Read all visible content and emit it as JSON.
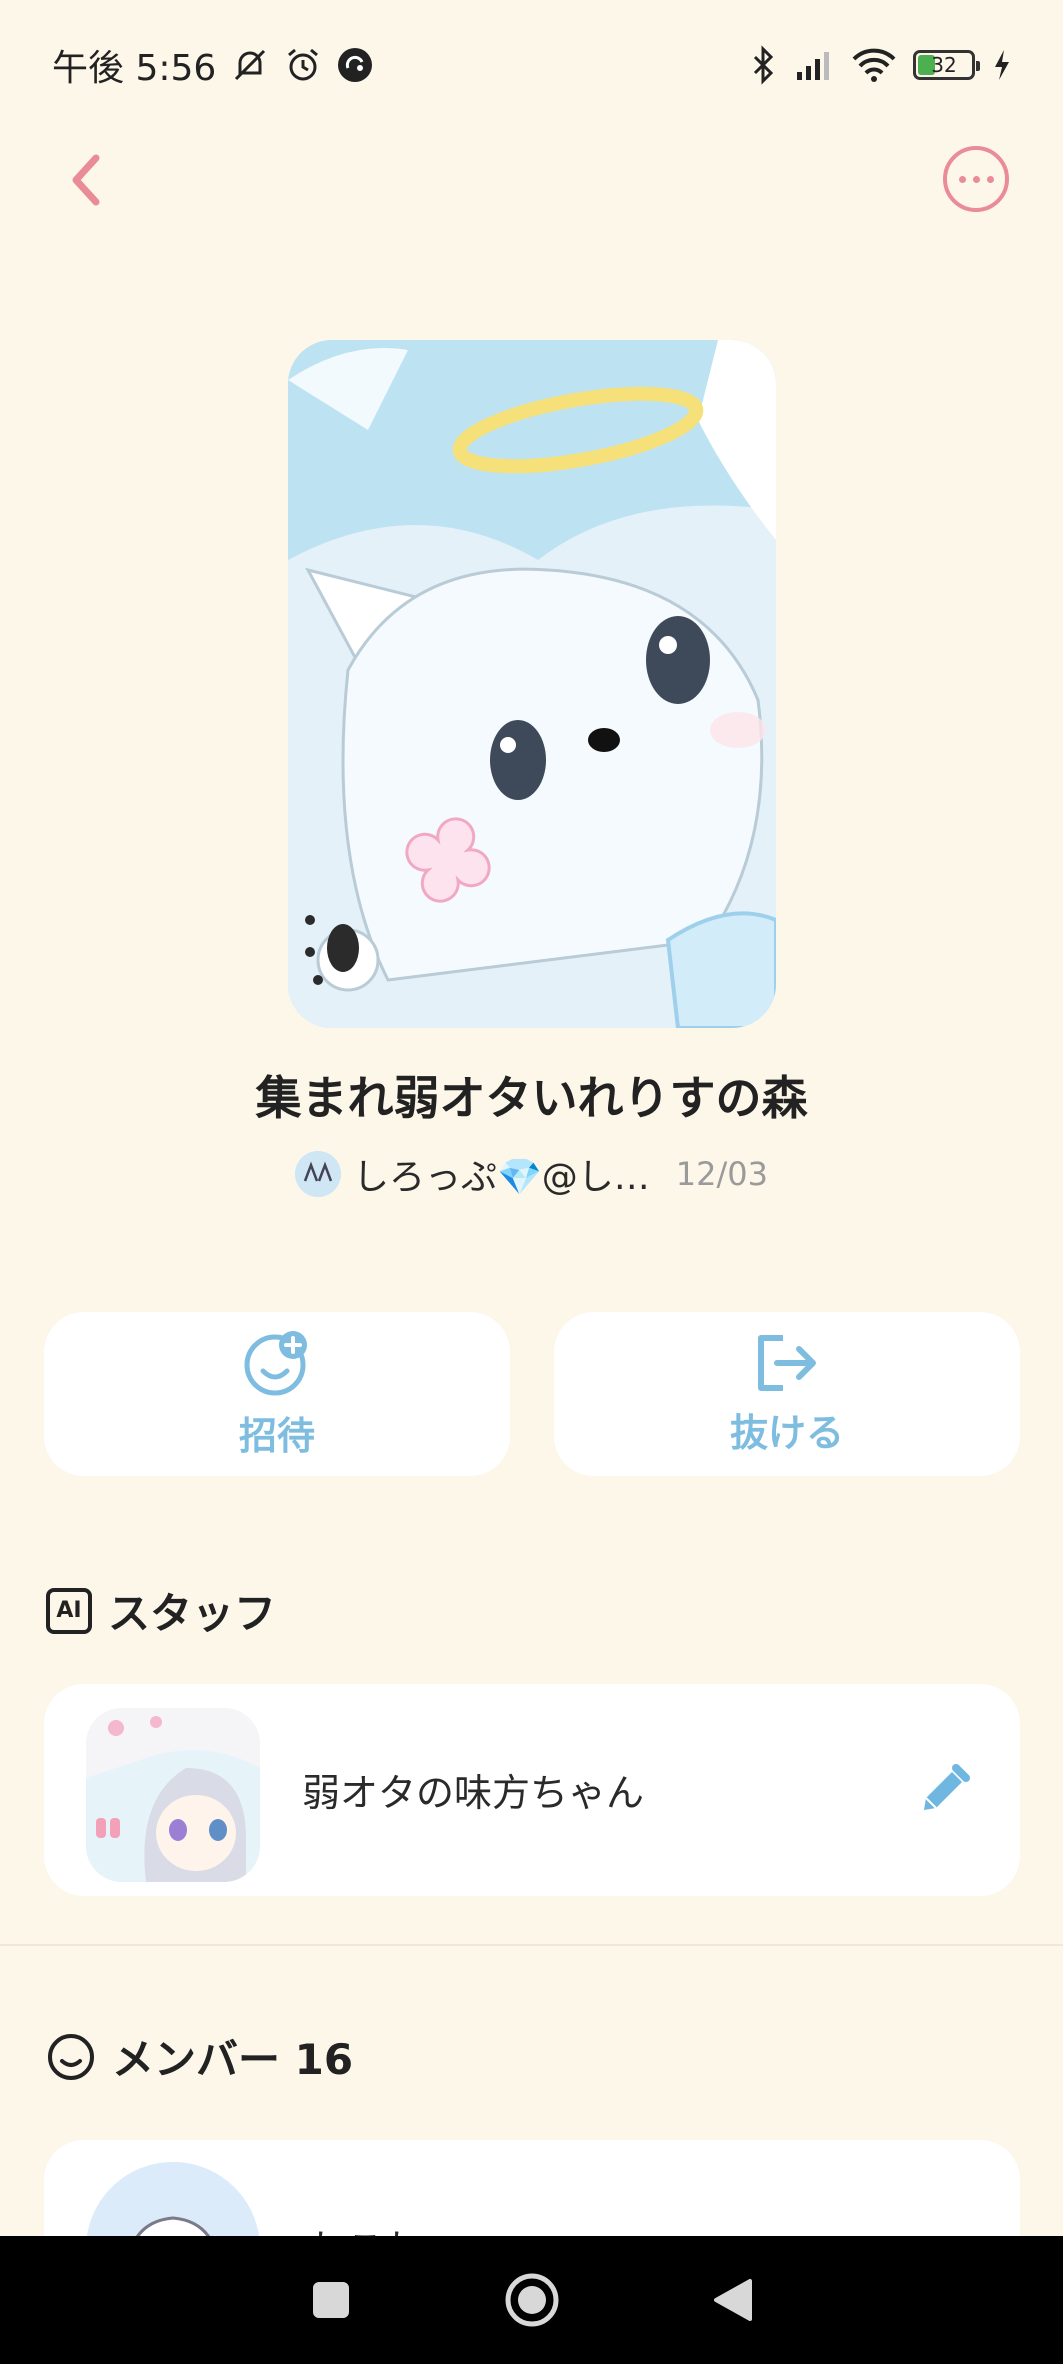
{
  "status_bar": {
    "time": "午後 5:56",
    "battery_level": "32",
    "icons": [
      "mute-icon",
      "alarm-icon",
      "vpn-icon",
      "bluetooth-icon",
      "signal-icon",
      "wifi-icon",
      "battery-icon",
      "charging-icon"
    ]
  },
  "nav": {
    "back_icon": "chevron-left-icon",
    "more_icon": "more-horizontal-icon",
    "accent_color": "#E98C97"
  },
  "group": {
    "title": "集まれ弱オタいれりすの森",
    "owner_name": "しろっぷ💎@し…",
    "created_date": "12/03"
  },
  "actions": {
    "invite_label": "招待",
    "leave_label": "抜ける",
    "color": "#7EBDE0"
  },
  "staff_section": {
    "badge": "AI",
    "heading": "スタッフ",
    "items": [
      {
        "name": "弱オタの味方ちゃん"
      }
    ]
  },
  "members_section": {
    "heading": "メンバー 16",
    "items": [
      {
        "name": "ねこね"
      }
    ]
  },
  "colors": {
    "background": "#FDF7EA",
    "card": "#FFFFFF"
  }
}
